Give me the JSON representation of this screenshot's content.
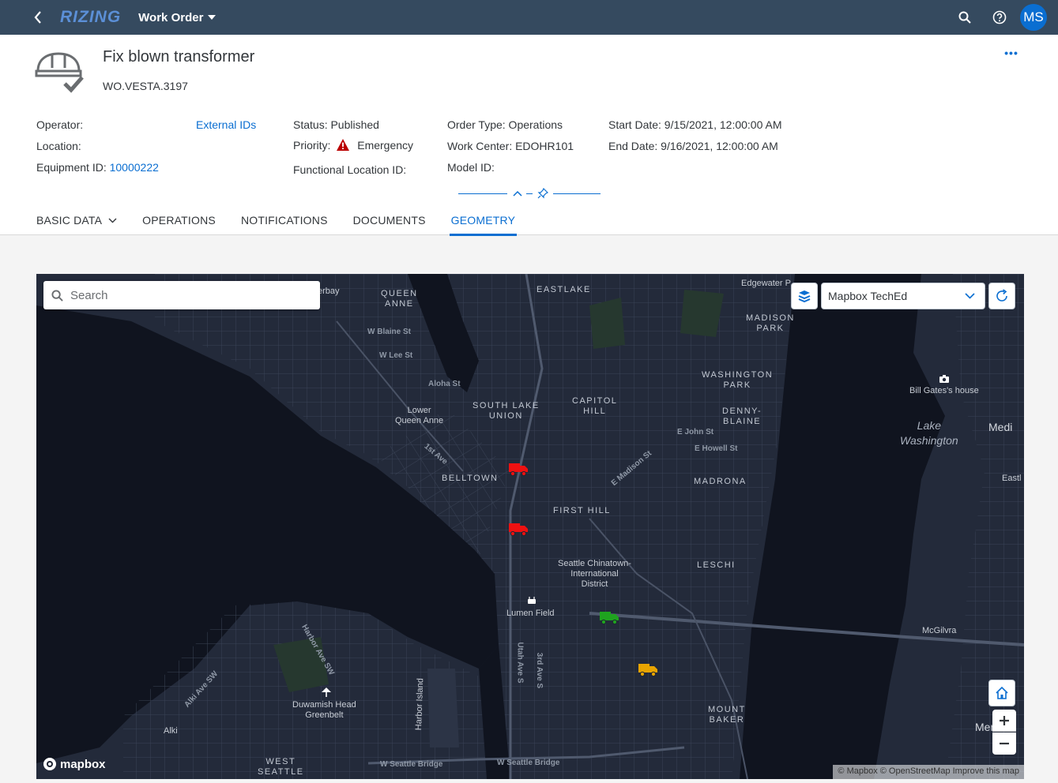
{
  "shell": {
    "logo": "RIZING",
    "title": "Work Order",
    "avatar": "MS"
  },
  "object": {
    "title": "Fix blown transformer",
    "id": "WO.VESTA.3197",
    "more": "•••"
  },
  "attributes": {
    "operator_label": "Operator:",
    "external_ids": "External IDs",
    "location_label": "Location:",
    "equipment_label": "Equipment ID:",
    "equipment_value": "10000222",
    "status": "Status: Published",
    "priority_label": "Priority:",
    "priority_value": "Emergency",
    "functional_location": "Functional Location ID:",
    "order_type": "Order Type: Operations",
    "work_center": "Work Center: EDOHR101",
    "model_id": "Model ID:",
    "start_date": "Start Date: 9/15/2021, 12:00:00 AM",
    "end_date": "End Date: 9/16/2021, 12:00:00 AM"
  },
  "tabs": [
    {
      "label": "BASIC DATA"
    },
    {
      "label": "OPERATIONS"
    },
    {
      "label": "NOTIFICATIONS"
    },
    {
      "label": "DOCUMENTS"
    },
    {
      "label": "GEOMETRY"
    }
  ],
  "active_tab": "GEOMETRY",
  "map": {
    "search_placeholder": "Search",
    "layer_selected": "Mapbox TechEd",
    "logo": "mapbox",
    "attribution": "© Mapbox © OpenStreetMap Improve this map",
    "labels": {
      "queen_anne": "QUEEN\nANNE",
      "eastlake": "EASTLAKE",
      "edgewater": "Edgewater P",
      "madison_park": "MADISON\nPARK",
      "washington_park": "WASHINGTON\nPARK",
      "bill_gates": "Bill Gates's house",
      "lake_washington": "Lake\nWashington",
      "medi": "Medi",
      "lower_queen_anne": "Lower\nQueen Anne",
      "south_lake_union": "SOUTH LAKE\nUNION",
      "capitol_hill": "CAPITOL\nHILL",
      "denny_blaine": "DENNY-\nBLAINE",
      "belltown": "BELLTOWN",
      "madrona": "MADRONA",
      "first_hill": "FIRST HILL",
      "chinatown": "Seattle Chinatown-\nInternational\nDistrict",
      "leschi": "LESCHI",
      "lumen_field": "Lumen Field",
      "mcgilvra": "McGilvra",
      "duwamish": "Duwamish Head\nGreenbelt",
      "alki": "Alki",
      "west_seattle": "WEST\nSEATTLE",
      "mount_baker": "MOUNT\nBAKER",
      "harbor_island": "Harbor Island",
      "erbay": "erbay",
      "eastl": "Eastl",
      "mer": "Mer",
      "w_blaine": "W Blaine St",
      "w_lee": "W Lee St",
      "aloha": "Aloha St",
      "e_john": "E John St",
      "e_howell": "E Howell St",
      "e_madison": "E Madison St",
      "w_seattle_bridge": "W Seattle Bridge",
      "w_seattle_bridge2": "W Seattle Bridge",
      "alki_ave": "Alki Ave SW",
      "harbor_ave": "Harbor Ave SW",
      "utah_ave": "Utah Ave S",
      "third_ave": "3rd Ave S",
      "first_ave": "1st Ave"
    },
    "trucks": [
      {
        "name": "truck-red-belltown",
        "color": "#ee1111"
      },
      {
        "name": "truck-red-downtown",
        "color": "#ee1111"
      },
      {
        "name": "truck-green",
        "color": "#1fa31f"
      },
      {
        "name": "truck-yellow",
        "color": "#e8a400"
      }
    ]
  },
  "colors": {
    "shell": "#354a5f",
    "accent": "#0a6ed1",
    "map_bg": "#1f2533",
    "water": "#0f1420",
    "error": "#bb0000"
  }
}
